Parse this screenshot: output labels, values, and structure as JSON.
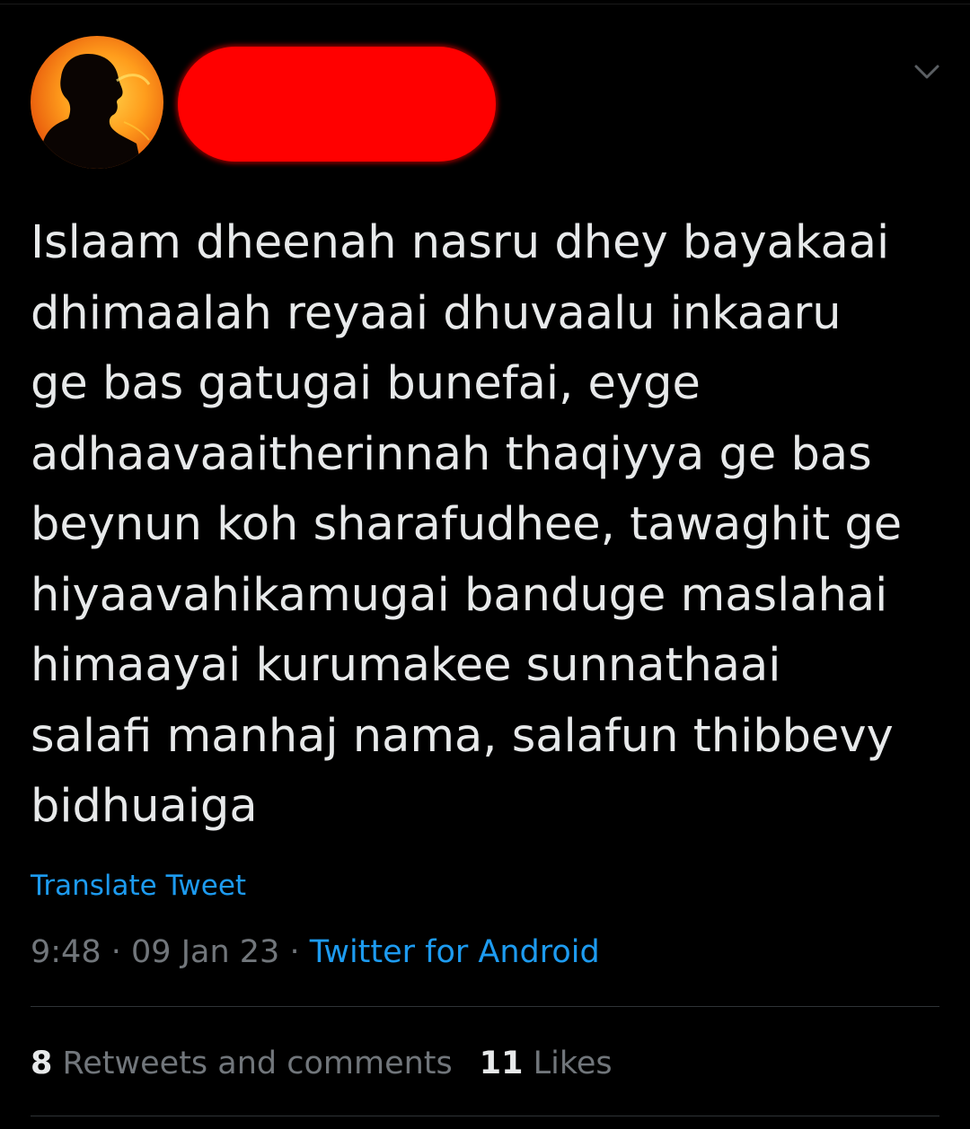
{
  "tweet": {
    "author_name_redacted": true,
    "text": "Islaam dheenah nasru dhey bayakaai\ndhimaalah reyaai dhuvaalu inkaaru\nge bas gatugai bunefai, eyge\nadhaavaaitherinnah thaqiyya ge bas\nbeynun koh sharafudhee, tawaghit ge\nhiyaavahikamugai banduge maslahai\nhimaayai kurumakee sunnathaai\nsalafi manhaj nama, salafun thibbevy\nbidhuaiga",
    "translate_label": "Translate Tweet",
    "time": "9:48",
    "separator": "·",
    "date": "09 Jan 23",
    "source": "Twitter for Android",
    "stats": {
      "retweets_count": "8",
      "retweets_label": "Retweets and comments",
      "likes_count": "11",
      "likes_label": "Likes"
    }
  },
  "colors": {
    "background": "#000000",
    "text": "#e7e9ea",
    "muted": "#71767b",
    "link": "#1d9bf0",
    "redaction": "#ff0000",
    "divider": "#2f3336"
  },
  "icons": {
    "menu": "chevron-down-icon",
    "avatar": "avatar"
  }
}
